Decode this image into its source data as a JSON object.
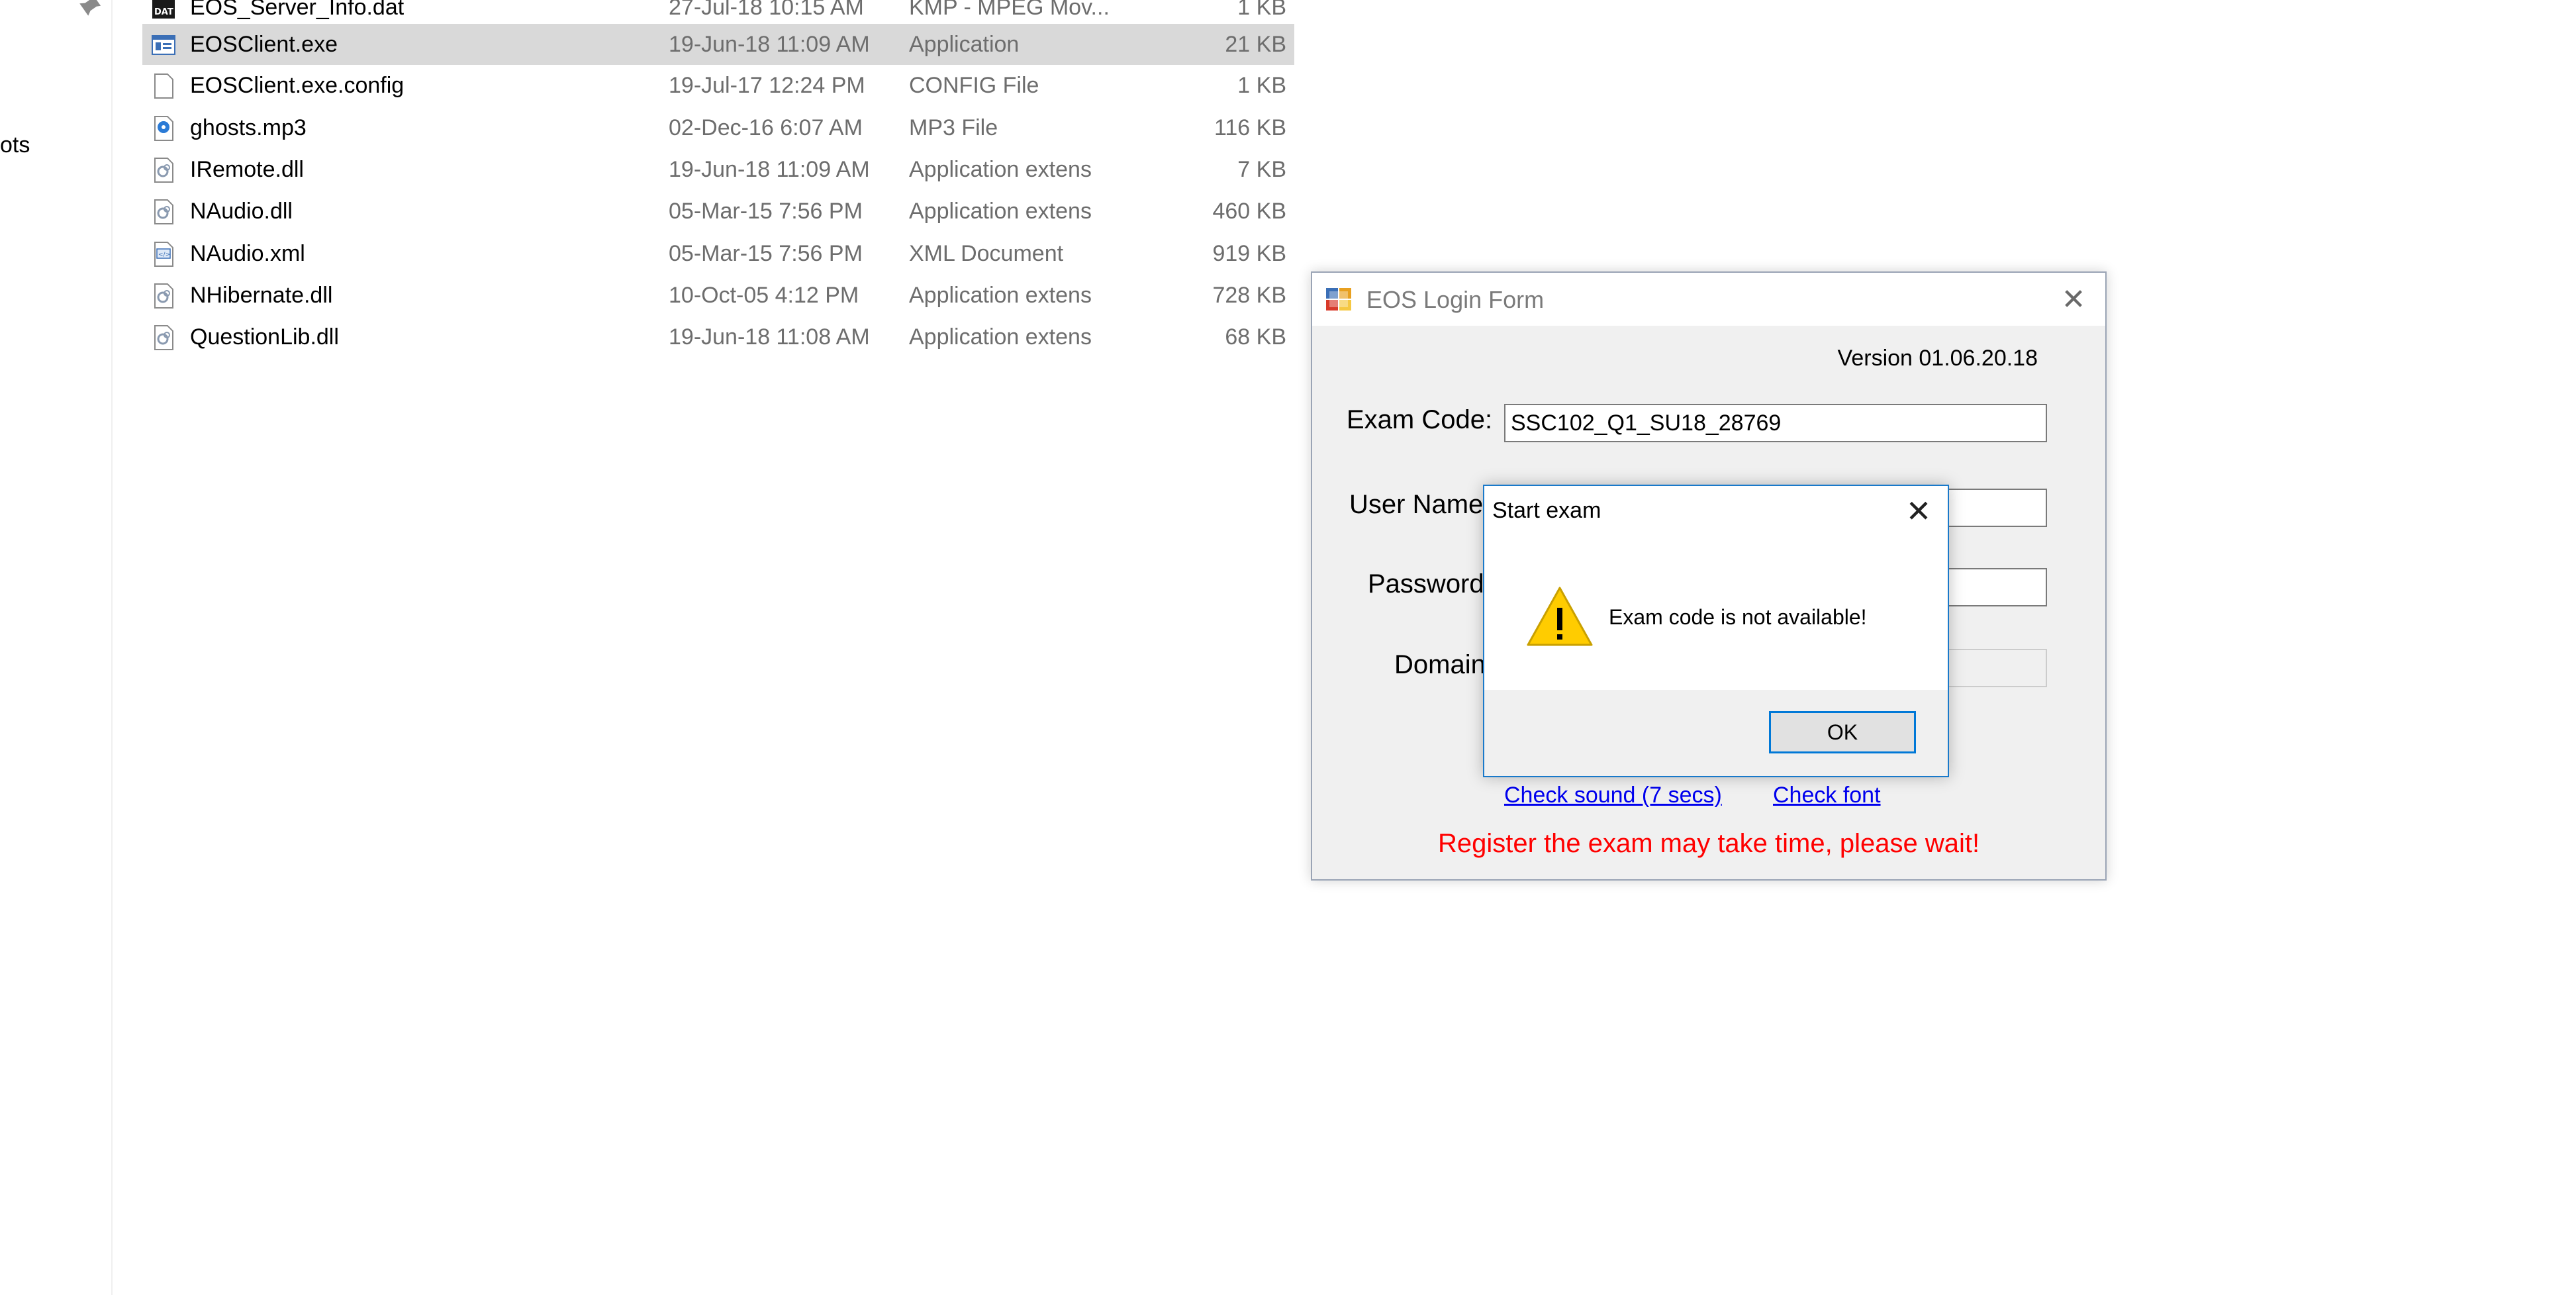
{
  "explorer": {
    "nav_label_fragment": "ots",
    "files": [
      {
        "name": "EOS_Server_Info.dat",
        "date": "27-Jul-18 10:15 AM",
        "type": "KMP - MPEG Mov...",
        "size": "1 KB",
        "icon": "dat-file-icon",
        "selected": false
      },
      {
        "name": "EOSClient.exe",
        "date": "19-Jun-18 11:09 AM",
        "type": "Application",
        "size": "21 KB",
        "icon": "exe-file-icon",
        "selected": true
      },
      {
        "name": "EOSClient.exe.config",
        "date": "19-Jul-17 12:24 PM",
        "type": "CONFIG File",
        "size": "1 KB",
        "icon": "blank-file-icon",
        "selected": false
      },
      {
        "name": "ghosts.mp3",
        "date": "02-Dec-16 6:07 AM",
        "type": "MP3 File",
        "size": "116 KB",
        "icon": "audio-file-icon",
        "selected": false
      },
      {
        "name": "IRemote.dll",
        "date": "19-Jun-18 11:09 AM",
        "type": "Application extens",
        "size": "7 KB",
        "icon": "dll-file-icon",
        "selected": false
      },
      {
        "name": "NAudio.dll",
        "date": "05-Mar-15 7:56 PM",
        "type": "Application extens",
        "size": "460 KB",
        "icon": "dll-file-icon",
        "selected": false
      },
      {
        "name": "NAudio.xml",
        "date": "05-Mar-15 7:56 PM",
        "type": "XML Document",
        "size": "919 KB",
        "icon": "xml-file-icon",
        "selected": false
      },
      {
        "name": "NHibernate.dll",
        "date": "10-Oct-05 4:12 PM",
        "type": "Application extens",
        "size": "728 KB",
        "icon": "dll-file-icon",
        "selected": false
      },
      {
        "name": "QuestionLib.dll",
        "date": "19-Jun-18 11:08 AM",
        "type": "Application extens",
        "size": "68 KB",
        "icon": "dll-file-icon",
        "selected": false
      }
    ]
  },
  "login_form": {
    "title": "EOS Login Form",
    "version": "Version 01.06.20.18",
    "exam_code_label": "Exam Code:",
    "exam_code_value": "SSC102_Q1_SU18_28769",
    "username_label": "User Name:",
    "password_label": "Password:",
    "domain_label": "Domain:",
    "check_sound_link": "Check sound (7 secs)",
    "check_font_link": "Check font",
    "warning": "Register the exam may take time, please wait!",
    "warning_color": "#ff0000"
  },
  "message_box": {
    "title": "Start exam",
    "message": "Exam code is not available!",
    "ok_label": "OK",
    "icon": "warning-icon"
  }
}
